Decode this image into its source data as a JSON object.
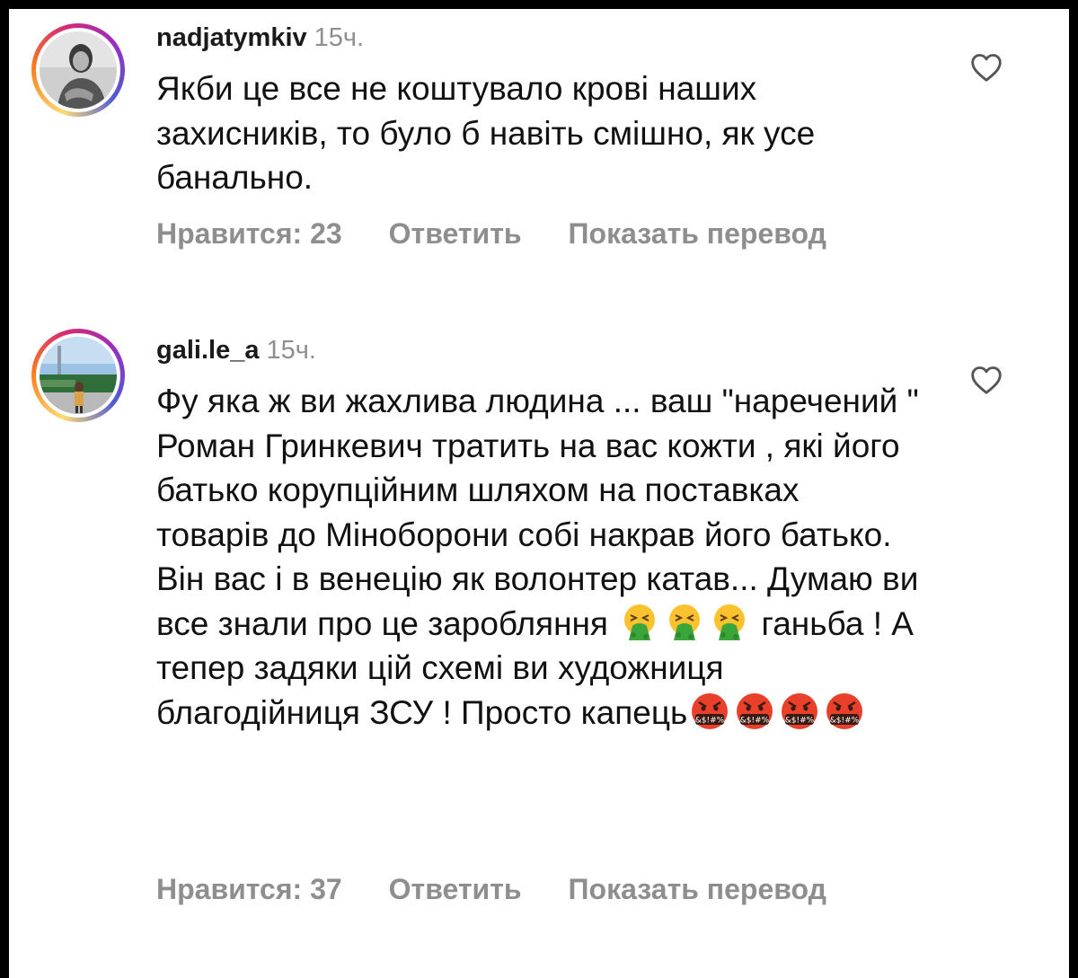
{
  "comments": [
    {
      "username": "nadjatymkiv",
      "time": "15ч.",
      "text": "Якби це все не коштувало крові наших захисників, то було б навіть смішно, як усе банально.",
      "likes_label": "Нравится: 23",
      "reply_label": "Ответить",
      "translate_label": "Показать перевод",
      "avatar": "woman-portrait-bw",
      "like_icon": "heart-outline-icon"
    },
    {
      "username": "gali.le_a",
      "time": "15ч.",
      "text_parts": [
        "Фу яка ж ви жахлива людина ... ваш \"наречений \" Роман Гринкевич тратить на вас кожти , які його батько корупційним шляхом на поставках товарів до Міноборони собі накрав його батько. Він вас і в венецію як волонтер катав... Думаю ви все знали про це заробляння",
        " ганьба ! А тепер задяки цій схемі ви художниця благодійниця ЗСУ ! Просто капець"
      ],
      "emoji_group_1": [
        "vomiting-face",
        "vomiting-face",
        "vomiting-face"
      ],
      "emoji_group_2": [
        "face-with-symbols-on-mouth",
        "face-with-symbols-on-mouth",
        "face-with-symbols-on-mouth",
        "face-with-symbols-on-mouth"
      ],
      "likes_label": "Нравится: 37",
      "reply_label": "Ответить",
      "translate_label": "Показать перевод",
      "avatar": "person-outdoors-photo",
      "like_icon": "heart-outline-icon"
    }
  ],
  "colors": {
    "text": "#111111",
    "muted": "#8e8e8e",
    "background": "#ffffff",
    "ring": [
      "#feda75",
      "#fa7e1e",
      "#d62976",
      "#962fbf",
      "#4f5bd5"
    ]
  }
}
